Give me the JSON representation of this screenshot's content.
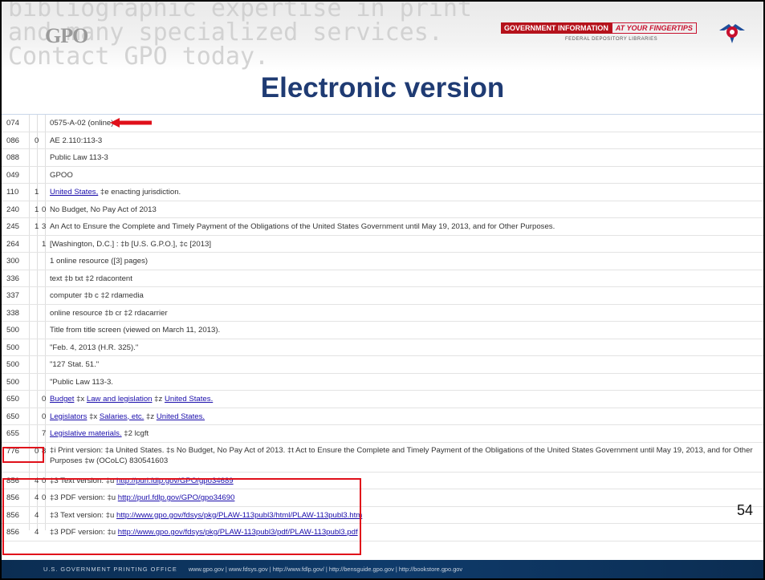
{
  "banner": {
    "bg_text": [
      "bibliographic expertise in print",
      "and many specialized services.",
      "Contact GPO today."
    ],
    "gpo_logo": "GPO",
    "gi_badge_left": "GOVERNMENT INFORMATION",
    "gi_badge_right": "AT YOUR FINGERTIPS",
    "gi_sub": "FEDERAL DEPOSITORY LIBRARIES"
  },
  "title": "Electronic version",
  "records": [
    {
      "tag": "074",
      "i1": "",
      "i2": "",
      "text": "0575-A-02 (online)"
    },
    {
      "tag": "086",
      "i1": "0",
      "i2": "",
      "text": "AE 2.110:113-3"
    },
    {
      "tag": "088",
      "i1": "",
      "i2": "",
      "text": "Public Law 113-3"
    },
    {
      "tag": "049",
      "i1": "",
      "i2": "",
      "text": "GPOO"
    },
    {
      "tag": "110",
      "i1": "1",
      "i2": "",
      "link": "United States,",
      "rest": " ‡e enacting jurisdiction."
    },
    {
      "tag": "240",
      "i1": "1",
      "i2": "0",
      "text": "No Budget, No Pay Act of 2013"
    },
    {
      "tag": "245",
      "i1": "1",
      "i2": "3",
      "text": "An Act to Ensure the Complete and Timely Payment of the Obligations of the United States Government until May 19, 2013, and for Other Purposes."
    },
    {
      "tag": "264",
      "i1": "",
      "i2": "1",
      "text": "[Washington, D.C.] : ‡b [U.S. G.P.O.], ‡c [2013]"
    },
    {
      "tag": "300",
      "i1": "",
      "i2": "",
      "text": "1 online resource ([3] pages)"
    },
    {
      "tag": "336",
      "i1": "",
      "i2": "",
      "text": "text ‡b txt ‡2 rdacontent"
    },
    {
      "tag": "337",
      "i1": "",
      "i2": "",
      "text": "computer ‡b c ‡2 rdamedia"
    },
    {
      "tag": "338",
      "i1": "",
      "i2": "",
      "text": "online resource ‡b cr ‡2 rdacarrier"
    },
    {
      "tag": "500",
      "i1": "",
      "i2": "",
      "text": "Title from title screen (viewed on March 11, 2013)."
    },
    {
      "tag": "500",
      "i1": "",
      "i2": "",
      "text": "\"Feb. 4, 2013 (H.R. 325).\""
    },
    {
      "tag": "500",
      "i1": "",
      "i2": "",
      "text": "\"127 Stat. 51.\""
    },
    {
      "tag": "500",
      "i1": "",
      "i2": "",
      "text": "\"Public Law 113-3."
    },
    {
      "tag": "650",
      "i1": "",
      "i2": "0",
      "parts": [
        {
          "link": "Budget"
        },
        {
          "plain": " ‡x "
        },
        {
          "link": "Law and legislation"
        },
        {
          "plain": " ‡z "
        },
        {
          "link": "United States."
        }
      ]
    },
    {
      "tag": "650",
      "i1": "",
      "i2": "0",
      "parts": [
        {
          "link": "Legislators"
        },
        {
          "plain": " ‡x "
        },
        {
          "link": "Salaries, etc."
        },
        {
          "plain": " ‡z "
        },
        {
          "link": "United States."
        }
      ]
    },
    {
      "tag": "655",
      "i1": "",
      "i2": "7",
      "parts": [
        {
          "link": "Legislative materials."
        },
        {
          "plain": " ‡2 lcgft"
        }
      ]
    },
    {
      "tag": "776",
      "i1": "0",
      "i2": "8",
      "tall": true,
      "text": "‡i Print version: ‡a United States. ‡s No Budget, No Pay Act of 2013. ‡t Act to Ensure the Complete and Timely Payment of the Obligations of the United States Government until May 19, 2013, and for Other Purposes ‡w (OCoLC) 830541603"
    },
    {
      "tag": "856",
      "i1": "4",
      "i2": "0",
      "prefix": "‡3 Text version: ‡u ",
      "url": "http://purl.fdlp.gov/GPO/gpo34689"
    },
    {
      "tag": "856",
      "i1": "4",
      "i2": "0",
      "prefix": "‡3 PDF version: ‡u ",
      "url": "http://purl.fdlp.gov/GPO/gpo34690"
    },
    {
      "tag": "856",
      "i1": "4",
      "i2": "",
      "prefix": "‡3 Text version: ‡u ",
      "url": "http://www.gpo.gov/fdsys/pkg/PLAW-113publ3/html/PLAW-113publ3.htm"
    },
    {
      "tag": "856",
      "i1": "4",
      "i2": "",
      "prefix": "‡3 PDF version: ‡u ",
      "url": "http://www.gpo.gov/fdsys/pkg/PLAW-113publ3/pdf/PLAW-113publ3.pdf"
    }
  ],
  "page_number": "54",
  "footer": {
    "org": "U.S. GOVERNMENT PRINTING OFFICE",
    "links": "www.gpo.gov  |  www.fdsys.gov  |  http://www.fdlp.gov/  |  http://bensguide.gpo.gov  |  http://bookstore.gpo.gov"
  },
  "colors": {
    "title": "#1f3b73",
    "annotation": "#e0101a",
    "link": "#1a0dab",
    "footer": "#0f3b6b"
  },
  "icons": [
    "fdlp-eagle-logo",
    "red-arrow-icon"
  ]
}
